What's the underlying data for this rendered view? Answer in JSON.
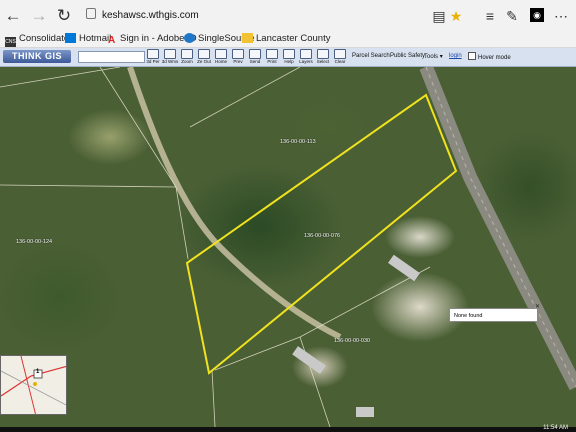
{
  "browser": {
    "url_host": "keshawsc.wthgis.com",
    "url_prefix": "",
    "icons": [
      "back-arrow",
      "forward-arrow",
      "refresh",
      "lock",
      "reading-view",
      "favorite-star",
      "hub",
      "note",
      "more"
    ]
  },
  "favorites": [
    {
      "label": "Consolidated",
      "icon": "cns-icon",
      "color": "#333333"
    },
    {
      "label": "Hotmail",
      "icon": "mail-icon",
      "color": "#0078d7"
    },
    {
      "label": "Sign in - Adobe ID",
      "icon": "adobe-icon",
      "color": "#e1251b"
    },
    {
      "label": "SingleSource",
      "icon": "singlesource-icon",
      "color": "#1f77c8"
    },
    {
      "label": "Lancaster County",
      "icon": "folder-icon",
      "color": "#f1c232"
    }
  ],
  "gis": {
    "logo": "THINK GIS",
    "search_value": "",
    "tools": [
      {
        "label": "3d Per",
        "name": "tool-3d-per"
      },
      {
        "label": "3d Wms",
        "name": "tool-3d-wms"
      },
      {
        "label": "Zoom",
        "name": "tool-zoom"
      },
      {
        "label": "Ze Out",
        "name": "tool-zoom-out"
      },
      {
        "label": "Home",
        "name": "tool-home"
      },
      {
        "label": "Prev",
        "name": "tool-prev"
      },
      {
        "label": "Send",
        "name": "tool-send"
      },
      {
        "label": "Print",
        "name": "tool-print"
      },
      {
        "label": "Help",
        "name": "tool-help"
      },
      {
        "label": "Layers",
        "name": "tool-layers"
      },
      {
        "label": "Select",
        "name": "tool-select"
      },
      {
        "label": "Clear",
        "name": "tool-clear"
      }
    ],
    "menu": {
      "parcel_search": "Parcel Search",
      "public_safety": "Public Safety",
      "tools": "Tools",
      "login": "login",
      "hover_mode": "Hover mode"
    },
    "accent": "#3d5a98"
  },
  "map": {
    "parcel_labels": [
      {
        "id": "lbl-113",
        "text": "136-00-00-113"
      },
      {
        "id": "lbl-076",
        "text": "136-00-00-076"
      },
      {
        "id": "lbl-124",
        "text": "136-00-00-124"
      },
      {
        "id": "lbl-030",
        "text": "136-00-00-030"
      }
    ],
    "popup_text": "None found",
    "highlight_color": "#f0e21e",
    "inset_route": "1"
  },
  "taskbar": {
    "time": "11:54 AM"
  }
}
